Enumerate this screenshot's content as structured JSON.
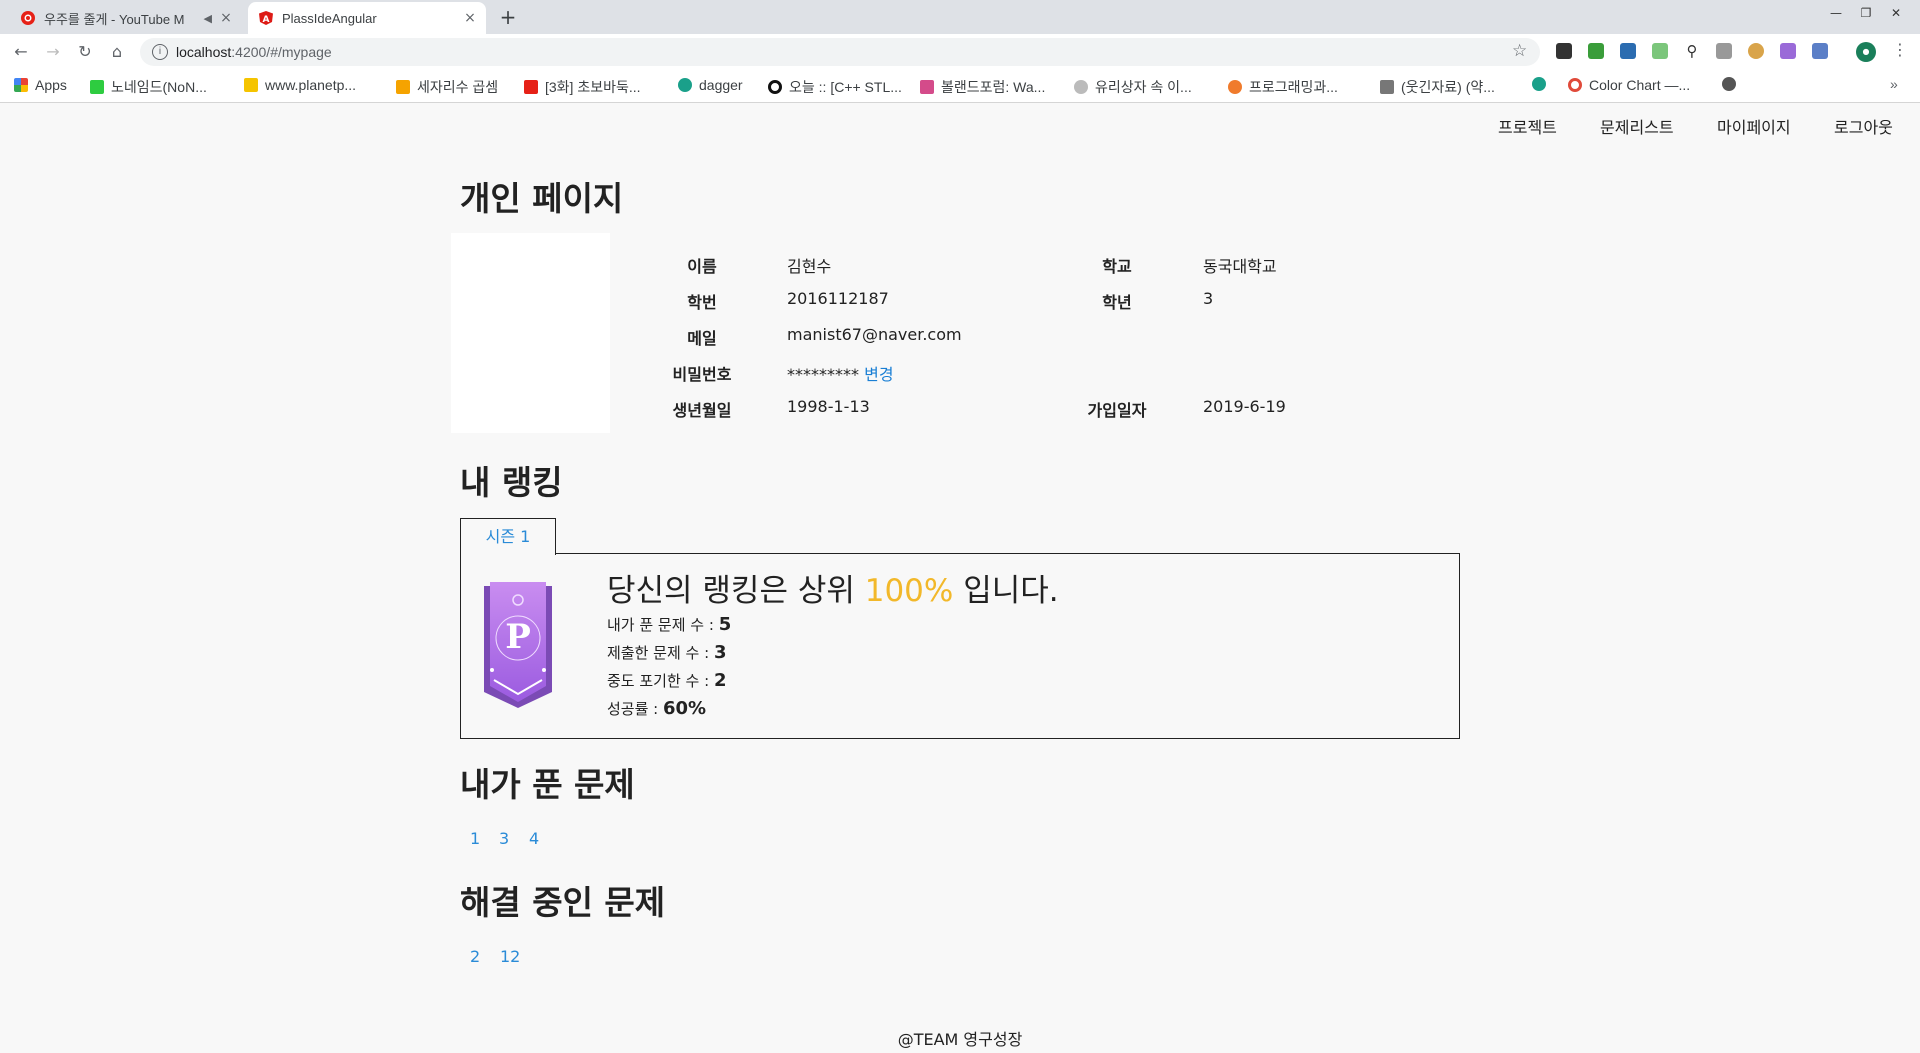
{
  "browser": {
    "tabs": [
      {
        "title": "우주를 줄게 - YouTube M",
        "close": "×"
      },
      {
        "title": "PlassIdeAngular",
        "close": "×"
      }
    ],
    "new_tab": "+",
    "url_host": "localhost",
    "url_path": ":4200/#/mypage",
    "bookmarks": [
      "Apps",
      "노네임드(NoN...",
      "www.planetp...",
      "세자리수 곱셈",
      "[3화] 초보바둑...",
      "dagger",
      "오늘 :: [C++ STL...",
      "볼랜드포럼: Wa...",
      "유리상자 속 이...",
      "프로그래밍과...",
      "(웃긴자료) (약...",
      "Color Chart —..."
    ],
    "colors": {
      "youtube": "#e62117",
      "angular": "#dd1b16",
      "accent": "#f2b82a",
      "link": "#2a8bd7"
    }
  },
  "nav": {
    "items": [
      "프로젝트",
      "문제리스트",
      "마이페이지",
      "로그아웃"
    ]
  },
  "profile": {
    "heading": "개인 페이지",
    "name_label": "이름",
    "name": "김현수",
    "school_label": "학교",
    "school": "동국대학교",
    "student_id_label": "학번",
    "student_id": "2016112187",
    "year_label": "학년",
    "year": "3",
    "email_label": "메일",
    "email": "manist67@naver.com",
    "password_label": "비밀번호",
    "password": "*********",
    "change": "변경",
    "birth_label": "생년월일",
    "birth": "1998-1-13",
    "joined_label": "가입일자",
    "joined": "2019-6-19"
  },
  "ranking": {
    "heading": "내 랭킹",
    "season_tab": "시즌 1",
    "title_before": "당신의 랭킹은 상위 ",
    "percent": "100%",
    "title_after": " 입니다.",
    "solved_label": "내가 푼 문제 수 : ",
    "solved": "5",
    "submitted_label": "제출한 문제 수 : ",
    "submitted": "3",
    "gaveup_label": "중도 포기한 수 : ",
    "gaveup": "2",
    "success_label": "성공률 : ",
    "success": "60%"
  },
  "solved_problems": {
    "heading": "내가 푼 문제",
    "items": [
      "1",
      "3",
      "4"
    ]
  },
  "in_progress": {
    "heading": "해결 중인 문제",
    "items": [
      "2",
      "12"
    ]
  },
  "footer": "@TEAM 영구성장"
}
